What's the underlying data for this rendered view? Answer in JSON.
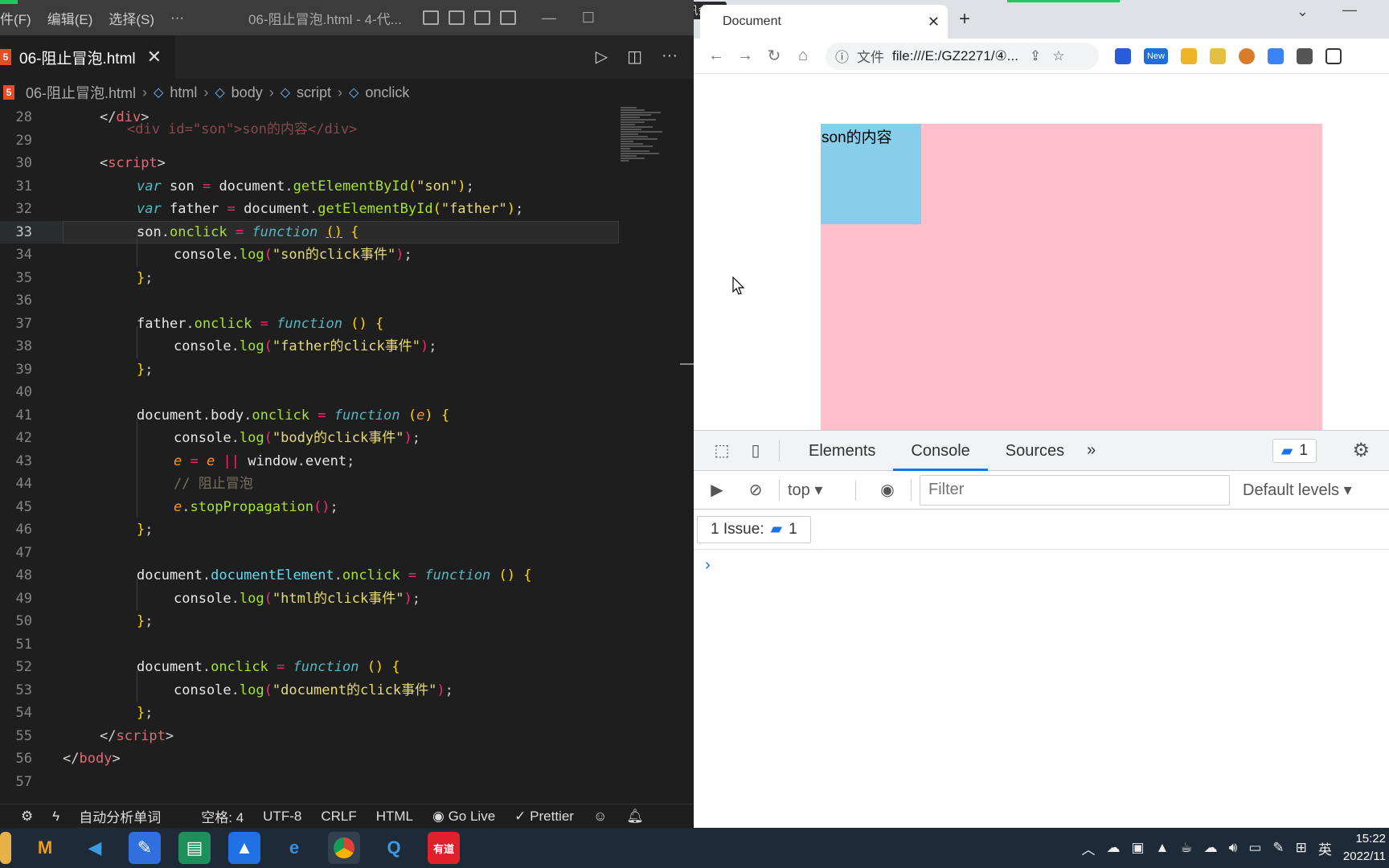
{
  "vscode": {
    "menus": [
      "件(F)",
      "编辑(E)",
      "选择(S)",
      "···"
    ],
    "window_title": "06-阻止冒泡.html - 4-代...",
    "tab_label": "06-阻止冒泡.html",
    "breadcrumb": [
      "06-阻止冒泡.html",
      "html",
      "body",
      "script",
      "onclick"
    ],
    "status": {
      "auto_analyze": "自动分析单词",
      "spaces": "空格: 4",
      "encoding": "UTF-8",
      "eol": "CRLF",
      "language": "HTML",
      "golive": "Go Live",
      "prettier": "Prettier"
    },
    "line_numbers": [
      "28",
      "29",
      "30",
      "31",
      "32",
      "33",
      "34",
      "35",
      "36",
      "37",
      "38",
      "39",
      "40",
      "41",
      "42",
      "43",
      "44",
      "45",
      "46",
      "47",
      "48",
      "49",
      "50",
      "51",
      "52",
      "53",
      "54",
      "55",
      "56",
      "57"
    ],
    "active_line": "33",
    "partial_top": "<div id=\"son\">son的内容</div>"
  },
  "browser": {
    "meeting_label": "腾讯会议",
    "tab_title": "Document",
    "omnibox_proto": "文件",
    "omnibox_url": "file:///E:/GZ2271/④...",
    "ext_new_badge": "New",
    "son_text": "son的内容",
    "son_color": "#87ceeb",
    "father_color": "#ffc0cb"
  },
  "devtools": {
    "tabs": [
      "Elements",
      "Console",
      "Sources"
    ],
    "active_tab": "Console",
    "more": "»",
    "issues_count": "1",
    "context": "top",
    "filter_placeholder": "Filter",
    "levels": "Default levels",
    "issue_label": "1 Issue:",
    "issue_num": "1",
    "prompt": "›"
  },
  "taskbar": {
    "ime": "英",
    "time": "15:22",
    "date": "2022/11"
  }
}
